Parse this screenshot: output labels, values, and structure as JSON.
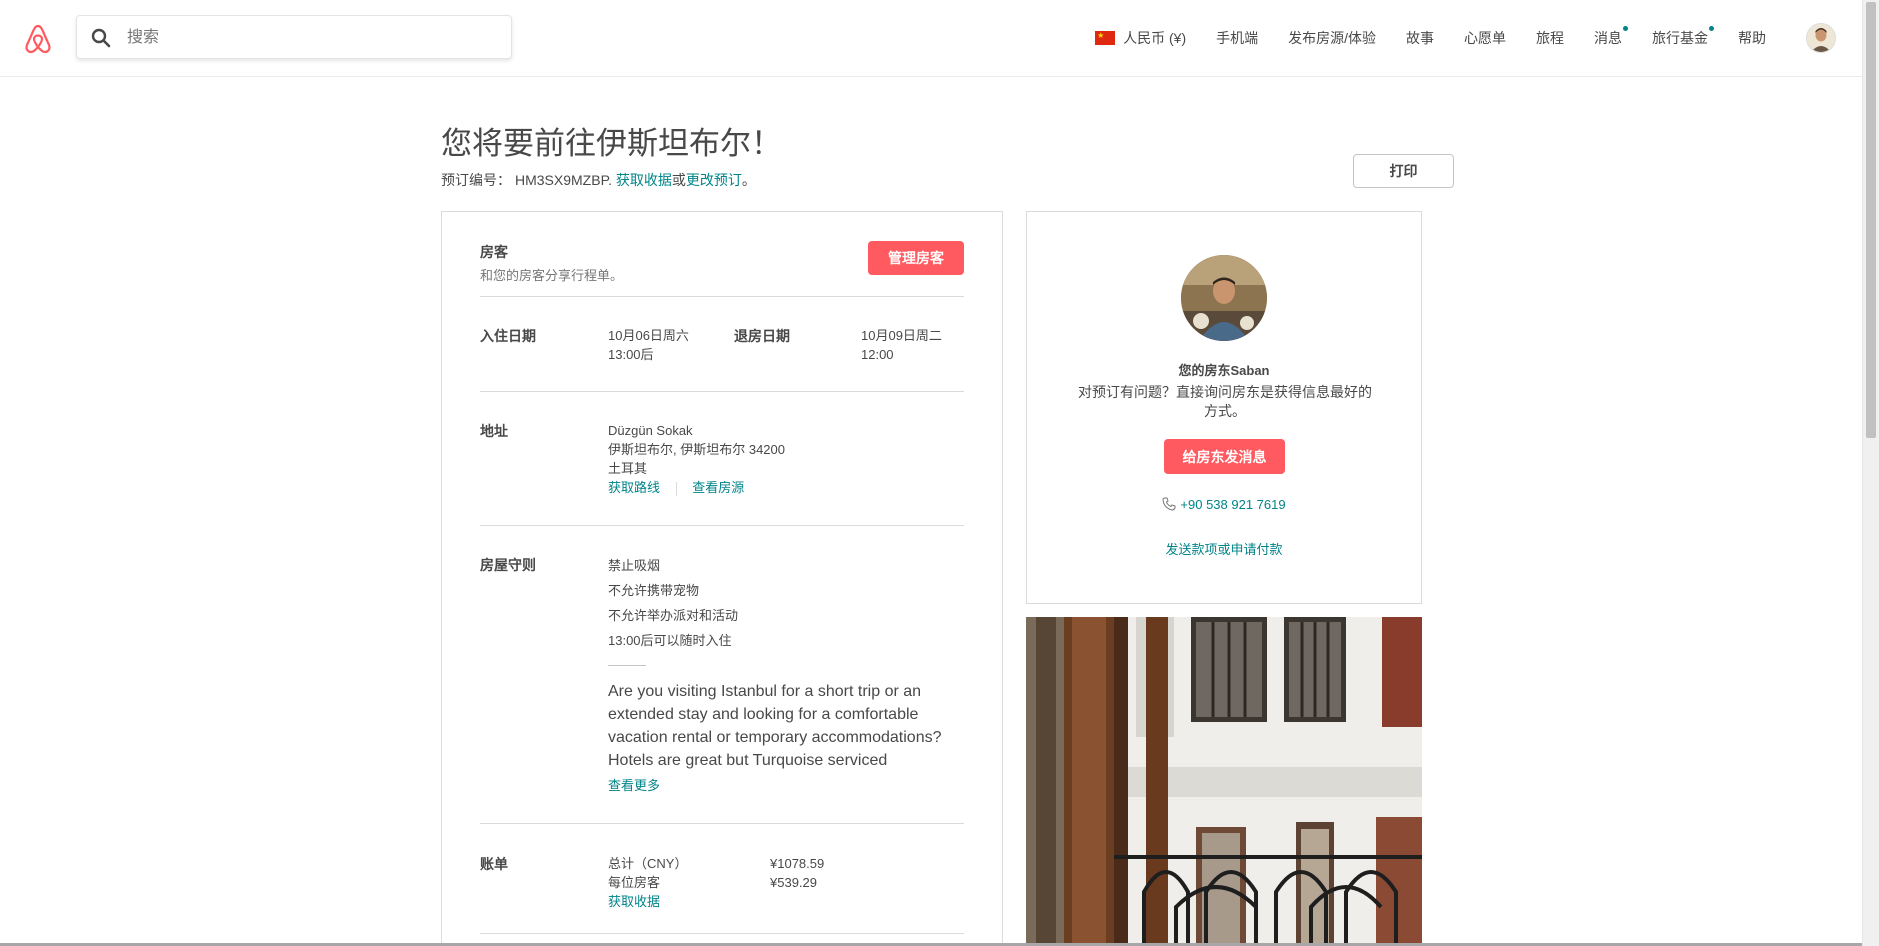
{
  "header": {
    "search_placeholder": "搜索",
    "nav": {
      "currency": "人民币 (¥)",
      "mobile": "手机端",
      "host": "发布房源/体验",
      "stories": "故事",
      "wishlist": "心愿单",
      "trips": "旅程",
      "messages": "消息",
      "travel_credit": "旅行基金",
      "help": "帮助"
    }
  },
  "page": {
    "title": "您将要前往伊斯坦布尔！",
    "booking_prefix": "预订编号：",
    "booking_code": "HM3SX9MZBP.",
    "get_receipt": "获取收据",
    "or": "或",
    "change_booking": "更改预订",
    "period": "。",
    "print": "打印"
  },
  "guests": {
    "label": "房客",
    "subtitle": "和您的房客分享行程单。",
    "manage_button": "管理房客"
  },
  "dates": {
    "checkin_label": "入住日期",
    "checkin_date": "10月06日周六",
    "checkin_time": "13:00后",
    "checkout_label": "退房日期",
    "checkout_date": "10月09日周二",
    "checkout_time": "12:00"
  },
  "address": {
    "label": "地址",
    "street": "Düzgün Sokak",
    "city": "伊斯坦布尔, 伊斯坦布尔 34200",
    "country": "土耳其",
    "directions": "获取路线",
    "view_listing": "查看房源"
  },
  "rules": {
    "label": "房屋守则",
    "items": [
      "禁止吸烟",
      "不允许携带宠物",
      "不允许举办派对和活动",
      "13:00后可以随时入住"
    ],
    "description": "Are you visiting Istanbul for a short trip or an extended stay and looking for a comfortable vacation rental or temporary accommodations? Hotels are great but Turquoise serviced",
    "read_more": "查看更多"
  },
  "billing": {
    "label": "账单",
    "total_label": "总计（CNY）",
    "total_value": "¥1078.59",
    "per_guest_label": "每位房客",
    "per_guest_value": "¥539.29",
    "receipt_link": "获取收据"
  },
  "host": {
    "name": "您的房东Saban",
    "question": "对预订有问题？直接询问房东是获得信息最好的方式。",
    "message_button": "给房东发消息",
    "phone": "+90 538 921 7619",
    "payment_link": "发送款项或申请付款"
  }
}
